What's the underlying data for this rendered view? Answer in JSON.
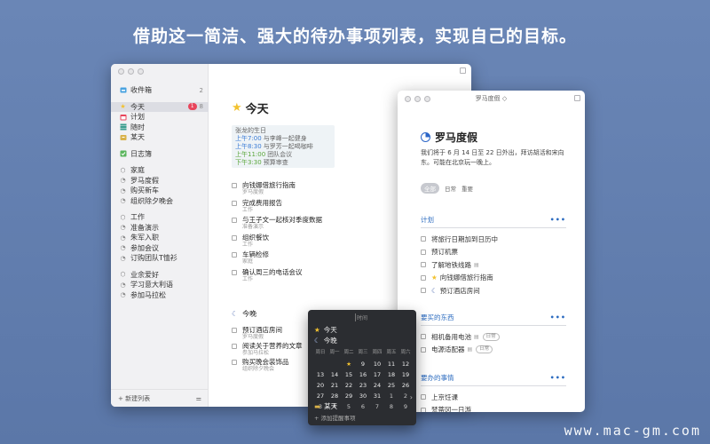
{
  "headline": "借助这一简洁、强大的待办事项列表，实现自己的目标。",
  "watermark": "www.mac-gm.com",
  "sidebar": {
    "inbox": {
      "label": "收件箱",
      "count": "2"
    },
    "today": {
      "label": "今天",
      "badge": "1",
      "count": "8"
    },
    "upcoming": {
      "label": "计划"
    },
    "anytime": {
      "label": "随时"
    },
    "someday": {
      "label": "某天"
    },
    "logbook": {
      "label": "日志簿"
    },
    "groups": [
      {
        "label": "家庭",
        "projects": [
          "罗马度假",
          "购买新车",
          "组织除夕晚会"
        ]
      },
      {
        "label": "工作",
        "projects": [
          "准备演示",
          "朱军入职",
          "参加会议",
          "订购团队T恤衫"
        ]
      },
      {
        "label": "业余爱好",
        "projects": [
          "学习意大利语",
          "参加马拉松"
        ]
      }
    ],
    "new_list": "新建列表"
  },
  "main": {
    "title": "今天",
    "calendar": [
      {
        "time": "",
        "text": "张龙的生日",
        "color": "#666666"
      },
      {
        "time": "上午7:00",
        "text": "与李峰一起健身",
        "color": "#3a7bd5"
      },
      {
        "time": "上午8:30",
        "text": "与罗芳一起喝咖啡",
        "color": "#3a7bd5"
      },
      {
        "time": "上午11:00",
        "text": "团队会议",
        "color": "#5aa63b"
      },
      {
        "time": "下午3:30",
        "text": "预算审查",
        "color": "#5aa63b"
      }
    ],
    "tasks": [
      {
        "title": "向钱娜借旅行指南",
        "project": "罗马度假"
      },
      {
        "title": "完成费用报告",
        "project": "工作"
      },
      {
        "title": "与王子文一起核对季度数据",
        "project": "准备演示"
      },
      {
        "title": "组织餐饮",
        "project": "工作"
      },
      {
        "title": "车辆检修",
        "project": "家庭"
      },
      {
        "title": "确认周三的电话会议",
        "project": "工作"
      }
    ],
    "evening_label": "今晚",
    "evening_tasks": [
      {
        "title": "预订酒店房间",
        "project": "罗马度假"
      },
      {
        "title": "阅读关于营养的文章",
        "project": "参加马拉松"
      },
      {
        "title": "购买晚会装饰品",
        "project": "组织除夕晚会"
      }
    ]
  },
  "project_window": {
    "window_title": "罗马度假 ◇",
    "title": "罗马度假",
    "notes": "我们将于 6 月 14 日至 22 日外出，拜访胡活和宋向东。可能在北京玩一晚上。",
    "tags": [
      "全部",
      "日常",
      "重要"
    ],
    "sections": [
      {
        "title": "计划",
        "tasks": [
          {
            "title": "将旅行日期加到日历中",
            "icon": "",
            "pill": ""
          },
          {
            "title": "预订机票",
            "icon": "",
            "pill": ""
          },
          {
            "title": "了解地铁线路",
            "icon": "",
            "pill": ""
          },
          {
            "title": "向钱娜借旅行指南",
            "icon": "★",
            "pill": ""
          },
          {
            "title": "预订酒店房间",
            "icon": "☾",
            "pill": ""
          }
        ]
      },
      {
        "title": "要买的东西",
        "tasks": [
          {
            "title": "相机备用电池",
            "icon": "",
            "pill": "日常"
          },
          {
            "title": "电源适配器",
            "icon": "",
            "pill": "日常"
          }
        ]
      },
      {
        "title": "要办的事情",
        "tasks": [
          {
            "title": "上京饪课",
            "icon": "",
            "pill": ""
          },
          {
            "title": "梵蒂冈一日游",
            "icon": "",
            "pill": ""
          }
        ]
      }
    ]
  },
  "popup": {
    "field": "时间",
    "today": "今天",
    "tonight": "今晚",
    "weekdays": [
      "周日",
      "周一",
      "周二",
      "周三",
      "周四",
      "周五",
      "周六"
    ],
    "weeks": [
      [
        "",
        "",
        "★",
        "9",
        "10",
        "11",
        "12"
      ],
      [
        "13",
        "14",
        "15",
        "16",
        "17",
        "18",
        "19"
      ],
      [
        "20",
        "21",
        "22",
        "23",
        "24",
        "25",
        "26"
      ],
      [
        "27",
        "28",
        "29",
        "30",
        "31",
        "1",
        "2"
      ],
      [
        "3",
        "4",
        "5",
        "6",
        "7",
        "8",
        "9"
      ]
    ],
    "next": "›",
    "someday": "某天",
    "add_reminder": "添加提醒事项"
  }
}
